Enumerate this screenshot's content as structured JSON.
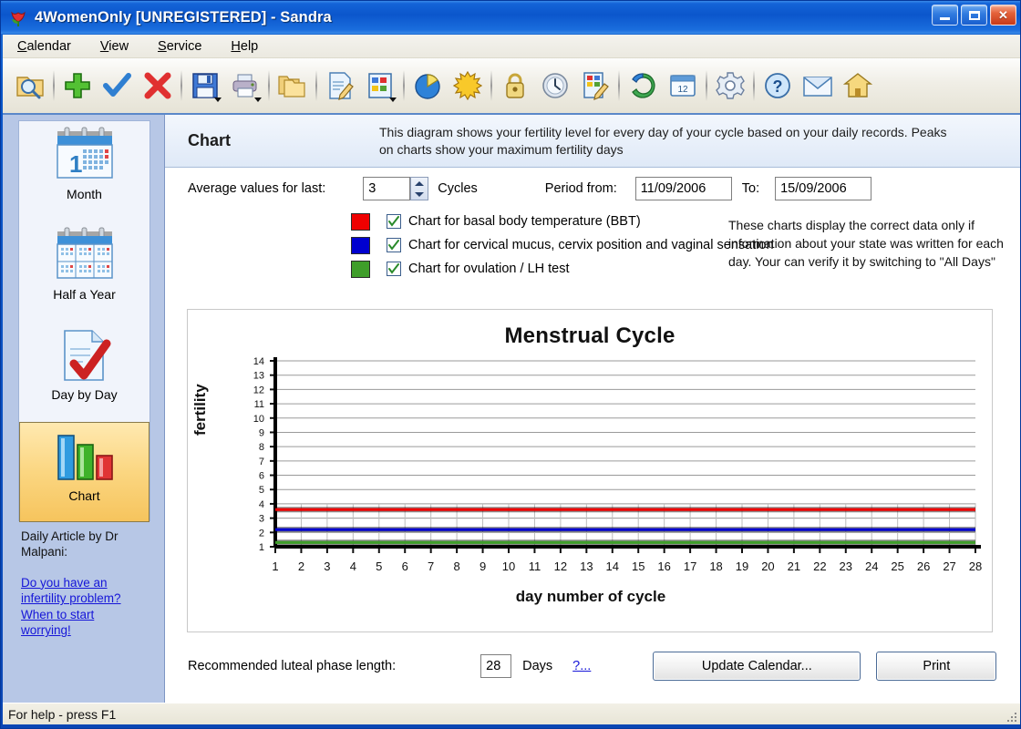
{
  "window": {
    "title": "4WomenOnly [UNREGISTERED] - Sandra",
    "app_icon": "tulip-icon",
    "minimize_label": "Minimize",
    "maximize_label": "Maximize",
    "close_label": "Close"
  },
  "menu": [
    {
      "label": "Calendar",
      "accel": "C"
    },
    {
      "label": "View",
      "accel": "V"
    },
    {
      "label": "Service",
      "accel": "S"
    },
    {
      "label": "Help",
      "accel": "H"
    }
  ],
  "toolbar": [
    {
      "name": "find-folder-icon",
      "group": 1
    },
    {
      "name": "add-plus-icon",
      "group": 2
    },
    {
      "name": "confirm-check-icon",
      "group": 2
    },
    {
      "name": "delete-cross-icon",
      "group": 2
    },
    {
      "name": "save-floppy-icon",
      "group": 3,
      "dropdown": true
    },
    {
      "name": "print-icon",
      "group": 3,
      "dropdown": true
    },
    {
      "name": "folders-icon",
      "group": 4
    },
    {
      "name": "edit-document-icon",
      "group": 5
    },
    {
      "name": "color-table-icon",
      "group": 5,
      "dropdown": true
    },
    {
      "name": "pie-chart-icon",
      "group": 6
    },
    {
      "name": "sun-icon",
      "group": 6
    },
    {
      "name": "lock-icon",
      "group": 7
    },
    {
      "name": "clock-icon",
      "group": 7
    },
    {
      "name": "notes-edit-icon",
      "group": 7
    },
    {
      "name": "refresh-globe-icon",
      "group": 8
    },
    {
      "name": "calendar-day-icon",
      "group": 8
    },
    {
      "name": "settings-gear-icon",
      "group": 9
    },
    {
      "name": "help-question-icon",
      "group": 10
    },
    {
      "name": "mail-icon",
      "group": 10
    },
    {
      "name": "home-icon",
      "group": 10
    }
  ],
  "sidebar": {
    "items": [
      {
        "label": "Month",
        "icon": "calendar-month-icon",
        "selected": false
      },
      {
        "label": "Half a Year",
        "icon": "calendar-halfyear-icon",
        "selected": false
      },
      {
        "label": "Day by Day",
        "icon": "day-check-icon",
        "selected": false
      },
      {
        "label": "Chart",
        "icon": "bar-chart-icon",
        "selected": true
      }
    ],
    "article_heading": "Daily Article by Dr Malpani:",
    "article_link_lines": [
      "Do you have an",
      "infertility problem?",
      "When to start",
      "worrying!"
    ]
  },
  "header": {
    "title": "Chart",
    "description": "This diagram shows your fertility level for every day of your cycle based on your daily records. Peaks on charts show your maximum fertility days"
  },
  "options": {
    "average_label": "Average values for last:",
    "average_value": "3",
    "cycles_label": "Cycles",
    "period_from_label": "Period from:",
    "period_from_value": "11/09/2006",
    "to_label": "To:",
    "to_value": "15/09/2006"
  },
  "legend": [
    {
      "color": "#ef0000",
      "checked": true,
      "label": "Chart for basal body temperature (BBT)"
    },
    {
      "color": "#0000cf",
      "checked": true,
      "label": "Chart for cervical mucus, cervix position and vaginal sensation"
    },
    {
      "color": "#3f9e2a",
      "checked": true,
      "label": "Chart for ovulation / LH test"
    }
  ],
  "note": "These charts display the correct data only if information about your state was written for each day. Your can verify it by switching to \"All Days\"",
  "chart_data": {
    "type": "line",
    "title": "Menstrual Cycle",
    "xlabel": "day number of cycle",
    "ylabel": "fertility",
    "categories": [
      1,
      2,
      3,
      4,
      5,
      6,
      7,
      8,
      9,
      10,
      11,
      12,
      13,
      14,
      15,
      16,
      17,
      18,
      19,
      20,
      21,
      22,
      23,
      24,
      25,
      26,
      27,
      28
    ],
    "xlim": [
      1,
      28
    ],
    "ylim": [
      1,
      14
    ],
    "yticks": [
      1,
      2,
      3,
      4,
      5,
      6,
      7,
      8,
      9,
      10,
      11,
      12,
      13,
      14
    ],
    "grid": true,
    "legend_position": "none",
    "series": [
      {
        "name": "Chart for basal body temperature (BBT)",
        "color": "#ef0000",
        "values": [
          3.6,
          3.6,
          3.6,
          3.6,
          3.6,
          3.6,
          3.6,
          3.6,
          3.6,
          3.6,
          3.6,
          3.6,
          3.6,
          3.6,
          3.6,
          3.6,
          3.6,
          3.6,
          3.6,
          3.6,
          3.6,
          3.6,
          3.6,
          3.6,
          3.6,
          3.6,
          3.6,
          3.6
        ]
      },
      {
        "name": "Chart for cervical mucus, cervix position and vaginal sensation",
        "color": "#0000cf",
        "values": [
          2.2,
          2.2,
          2.2,
          2.2,
          2.2,
          2.2,
          2.2,
          2.2,
          2.2,
          2.2,
          2.2,
          2.2,
          2.2,
          2.2,
          2.2,
          2.2,
          2.2,
          2.2,
          2.2,
          2.2,
          2.2,
          2.2,
          2.2,
          2.2,
          2.2,
          2.2,
          2.2,
          2.2
        ]
      },
      {
        "name": "Chart for ovulation / LH test",
        "color": "#3f9e2a",
        "values": [
          1.3,
          1.3,
          1.3,
          1.3,
          1.3,
          1.3,
          1.3,
          1.3,
          1.3,
          1.3,
          1.3,
          1.3,
          1.3,
          1.3,
          1.3,
          1.3,
          1.3,
          1.3,
          1.3,
          1.3,
          1.3,
          1.3,
          1.3,
          1.3,
          1.3,
          1.3,
          1.3,
          1.3
        ]
      }
    ]
  },
  "bottom": {
    "luteal_label": "Recommended luteal phase length:",
    "luteal_value": "28",
    "days_label": "Days",
    "help_link": "?...",
    "update_button": "Update Calendar...",
    "print_button": "Print"
  },
  "status": {
    "text": "For help - press F1"
  }
}
